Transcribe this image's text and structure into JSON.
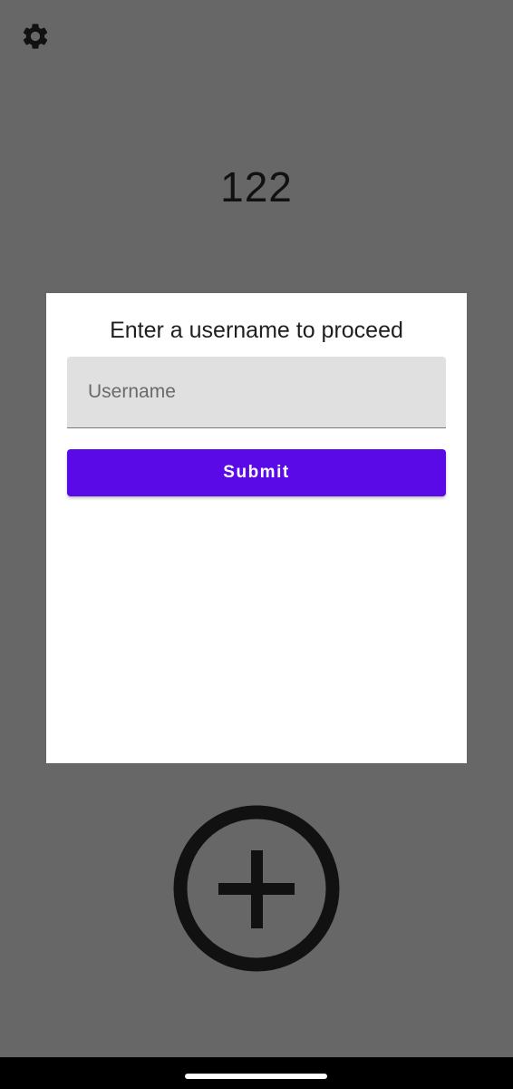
{
  "toolbar": {
    "settings_icon": "gear-icon"
  },
  "counter": {
    "value": "122"
  },
  "dialog": {
    "title": "Enter a username to proceed",
    "username_placeholder": "Username",
    "username_value": "",
    "submit_label": "Submit",
    "submit_color": "#5a0ae6"
  },
  "fab": {
    "icon": "add-circle-icon"
  },
  "colors": {
    "background": "#676767",
    "dialog": "#ffffff",
    "accent": "#5a0ae6",
    "icon": "#111111"
  }
}
